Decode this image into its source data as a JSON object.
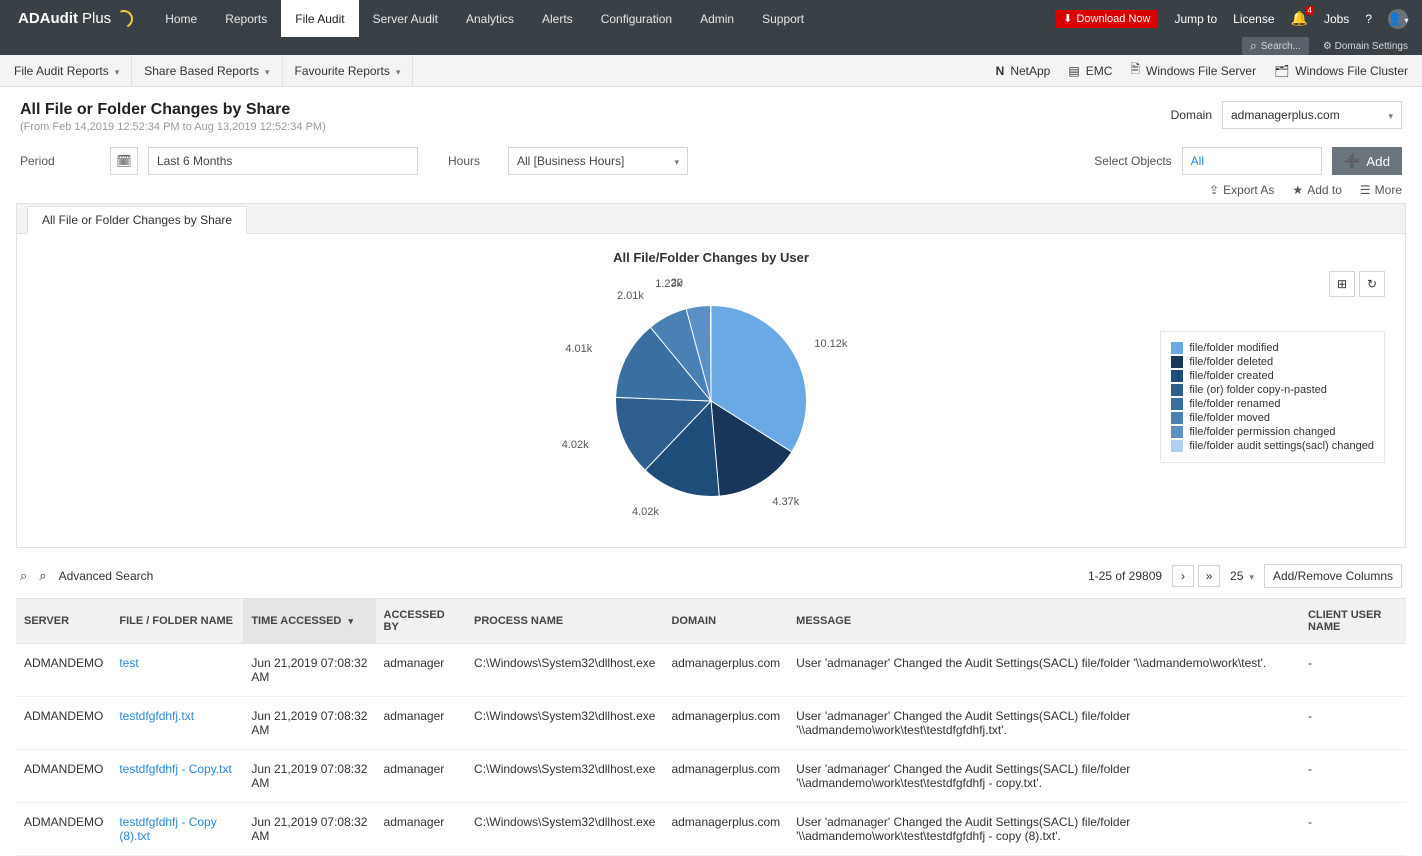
{
  "app": {
    "logo_a": "ADAudit",
    "logo_b": "Plus"
  },
  "topnav": {
    "tabs": [
      "Home",
      "Reports",
      "File Audit",
      "Server Audit",
      "Analytics",
      "Alerts",
      "Configuration",
      "Admin",
      "Support"
    ],
    "active": "File Audit",
    "download": "Download Now",
    "jump": "Jump to",
    "license": "License",
    "jobs": "Jobs",
    "help": "?",
    "bell_badge": "4"
  },
  "subbar": {
    "search": "Search...",
    "domain_settings": "Domain Settings"
  },
  "filterbar": {
    "menus": [
      "File Audit Reports",
      "Share Based Reports",
      "Favourite Reports"
    ],
    "sources": [
      "NetApp",
      "EMC",
      "Windows File Server",
      "Windows File Cluster"
    ]
  },
  "page": {
    "title": "All File or Folder Changes by Share",
    "range": "(From Feb 14,2019 12:52:34 PM to Aug 13,2019 12:52:34 PM)",
    "domain_label": "Domain",
    "domain_value": "admanagerplus.com"
  },
  "filters": {
    "period_label": "Period",
    "period_value": "Last 6 Months",
    "hours_label": "Hours",
    "hours_value": "All [Business Hours]",
    "objects_label": "Select Objects",
    "objects_value": "All",
    "add": "Add"
  },
  "actions": {
    "export": "Export As",
    "addto": "Add to",
    "more": "More"
  },
  "report_tab": "All File or Folder Changes by Share",
  "chart_data": {
    "type": "pie",
    "title": "All File/Folder Changes by User",
    "series": [
      {
        "name": "file/folder modified",
        "value": 10120,
        "label": "10.12k",
        "color": "#6aa9e4"
      },
      {
        "name": "file/folder deleted",
        "value": 4370,
        "label": "4.37k",
        "color": "#17365a"
      },
      {
        "name": "file/folder created",
        "value": 4020,
        "label": "4.02k",
        "color": "#1e4d7a"
      },
      {
        "name": "file/folder permission changed",
        "value": 4020,
        "label": "4.02k",
        "color": "#2d5e8e"
      },
      {
        "name": "file (or) folder copy-n-pasted",
        "value": 4010,
        "label": "4.01k",
        "color": "#3a6fa1"
      },
      {
        "name": "file/folder renamed",
        "value": 2010,
        "label": "2.01k",
        "color": "#4a80b3"
      },
      {
        "name": "file/folder moved",
        "value": 1230,
        "label": "1.23k",
        "color": "#5a90c5"
      },
      {
        "name": "file/folder audit settings(sacl) changed",
        "value": 20,
        "label": "20",
        "color": "#afd0ee"
      }
    ],
    "legend": [
      {
        "name": "file/folder modified",
        "color": "#6aa9e4"
      },
      {
        "name": "file/folder deleted",
        "color": "#17365a"
      },
      {
        "name": "file/folder created",
        "color": "#1e4d7a"
      },
      {
        "name": "file (or) folder copy-n-pasted",
        "color": "#2d5e8e"
      },
      {
        "name": "file/folder renamed",
        "color": "#3a6fa1"
      },
      {
        "name": "file/folder moved",
        "color": "#4a80b3"
      },
      {
        "name": "file/folder permission changed",
        "color": "#5a90c5"
      },
      {
        "name": "file/folder audit settings(sacl) changed",
        "color": "#afd0ee"
      }
    ]
  },
  "table_toolbar": {
    "advanced": "Advanced Search",
    "range": "1-25 of 29809",
    "pagesize": "25",
    "addremove": "Add/Remove Columns"
  },
  "columns": [
    "SERVER",
    "FILE / FOLDER NAME",
    "TIME ACCESSED",
    "ACCESSED BY",
    "PROCESS NAME",
    "DOMAIN",
    "MESSAGE",
    "CLIENT USER NAME"
  ],
  "rows": [
    {
      "server": "ADMANDEMO",
      "file": "test",
      "time": "Jun 21,2019 07:08:32 AM",
      "by": "admanager",
      "proc": "C:\\Windows\\System32\\dllhost.exe",
      "domain": "admanagerplus.com",
      "msg": "User 'admanager' Changed the Audit Settings(SACL) file/folder '\\\\admandemo\\work\\test'.",
      "client": "-"
    },
    {
      "server": "ADMANDEMO",
      "file": "testdfgfdhfj.txt",
      "time": "Jun 21,2019 07:08:32 AM",
      "by": "admanager",
      "proc": "C:\\Windows\\System32\\dllhost.exe",
      "domain": "admanagerplus.com",
      "msg": "User 'admanager' Changed the Audit Settings(SACL) file/folder '\\\\admandemo\\work\\test\\testdfgfdhfj.txt'.",
      "client": "-"
    },
    {
      "server": "ADMANDEMO",
      "file": "testdfgfdhfj - Copy.txt",
      "time": "Jun 21,2019 07:08:32 AM",
      "by": "admanager",
      "proc": "C:\\Windows\\System32\\dllhost.exe",
      "domain": "admanagerplus.com",
      "msg": "User 'admanager' Changed the Audit Settings(SACL) file/folder '\\\\admandemo\\work\\test\\testdfgfdhfj - copy.txt'.",
      "client": "-"
    },
    {
      "server": "ADMANDEMO",
      "file": "testdfgfdhfj - Copy (8).txt",
      "time": "Jun 21,2019 07:08:32 AM",
      "by": "admanager",
      "proc": "C:\\Windows\\System32\\dllhost.exe",
      "domain": "admanagerplus.com",
      "msg": "User 'admanager' Changed the Audit Settings(SACL) file/folder '\\\\admandemo\\work\\test\\testdfgfdhfj - copy (8).txt'.",
      "client": "-"
    }
  ]
}
